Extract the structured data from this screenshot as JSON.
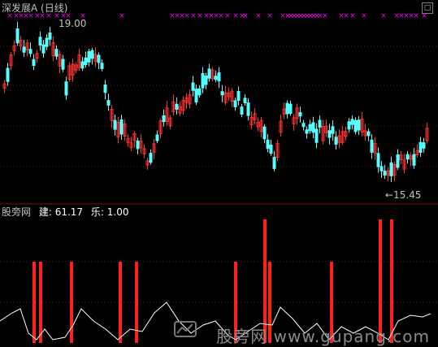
{
  "window": {
    "title": "深发展A (日线)"
  },
  "price_panel": {
    "high_label": "19.00",
    "low_label": "←15.45",
    "signal_marker": "×"
  },
  "indicator_panel": {
    "name": "股旁网",
    "jian_label": "建: 61.17",
    "le_label": "乐: 1.00"
  },
  "watermark": {
    "text": "股旁网  www.gupang.com"
  },
  "colors": {
    "background": "#000000",
    "up_candle": "#ff3232",
    "down_candle": "#54ffff",
    "signal": "#ff00ff",
    "bar": "#ff2020",
    "line": "#ffffff",
    "grid": "#7a1010"
  },
  "icons": {
    "toggle": "maximize-icon"
  }
}
